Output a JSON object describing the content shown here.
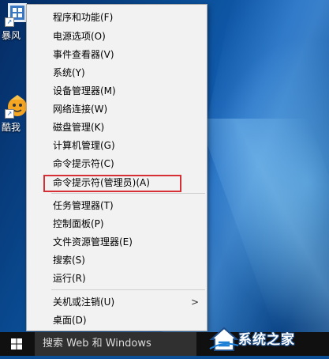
{
  "desktop": {
    "icons": [
      {
        "label": "暴风"
      },
      {
        "label": "酷我"
      }
    ]
  },
  "menu": {
    "items": [
      {
        "label": "程序和功能(F)"
      },
      {
        "label": "电源选项(O)"
      },
      {
        "label": "事件查看器(V)"
      },
      {
        "label": "系统(Y)"
      },
      {
        "label": "设备管理器(M)"
      },
      {
        "label": "网络连接(W)"
      },
      {
        "label": "磁盘管理(K)"
      },
      {
        "label": "计算机管理(G)"
      },
      {
        "label": "命令提示符(C)"
      },
      {
        "label": "命令提示符(管理员)(A)"
      },
      {
        "label": "任务管理器(T)"
      },
      {
        "label": "控制面板(P)"
      },
      {
        "label": "文件资源管理器(E)"
      },
      {
        "label": "搜索(S)"
      },
      {
        "label": "运行(R)"
      },
      {
        "label": "关机或注销(U)",
        "submenu_arrow": ">"
      },
      {
        "label": "桌面(D)"
      }
    ],
    "highlight_color": "#d62f35"
  },
  "taskbar": {
    "search_text": "搜索 Web 和 Windows"
  },
  "watermark": {
    "text": "系统之家"
  }
}
